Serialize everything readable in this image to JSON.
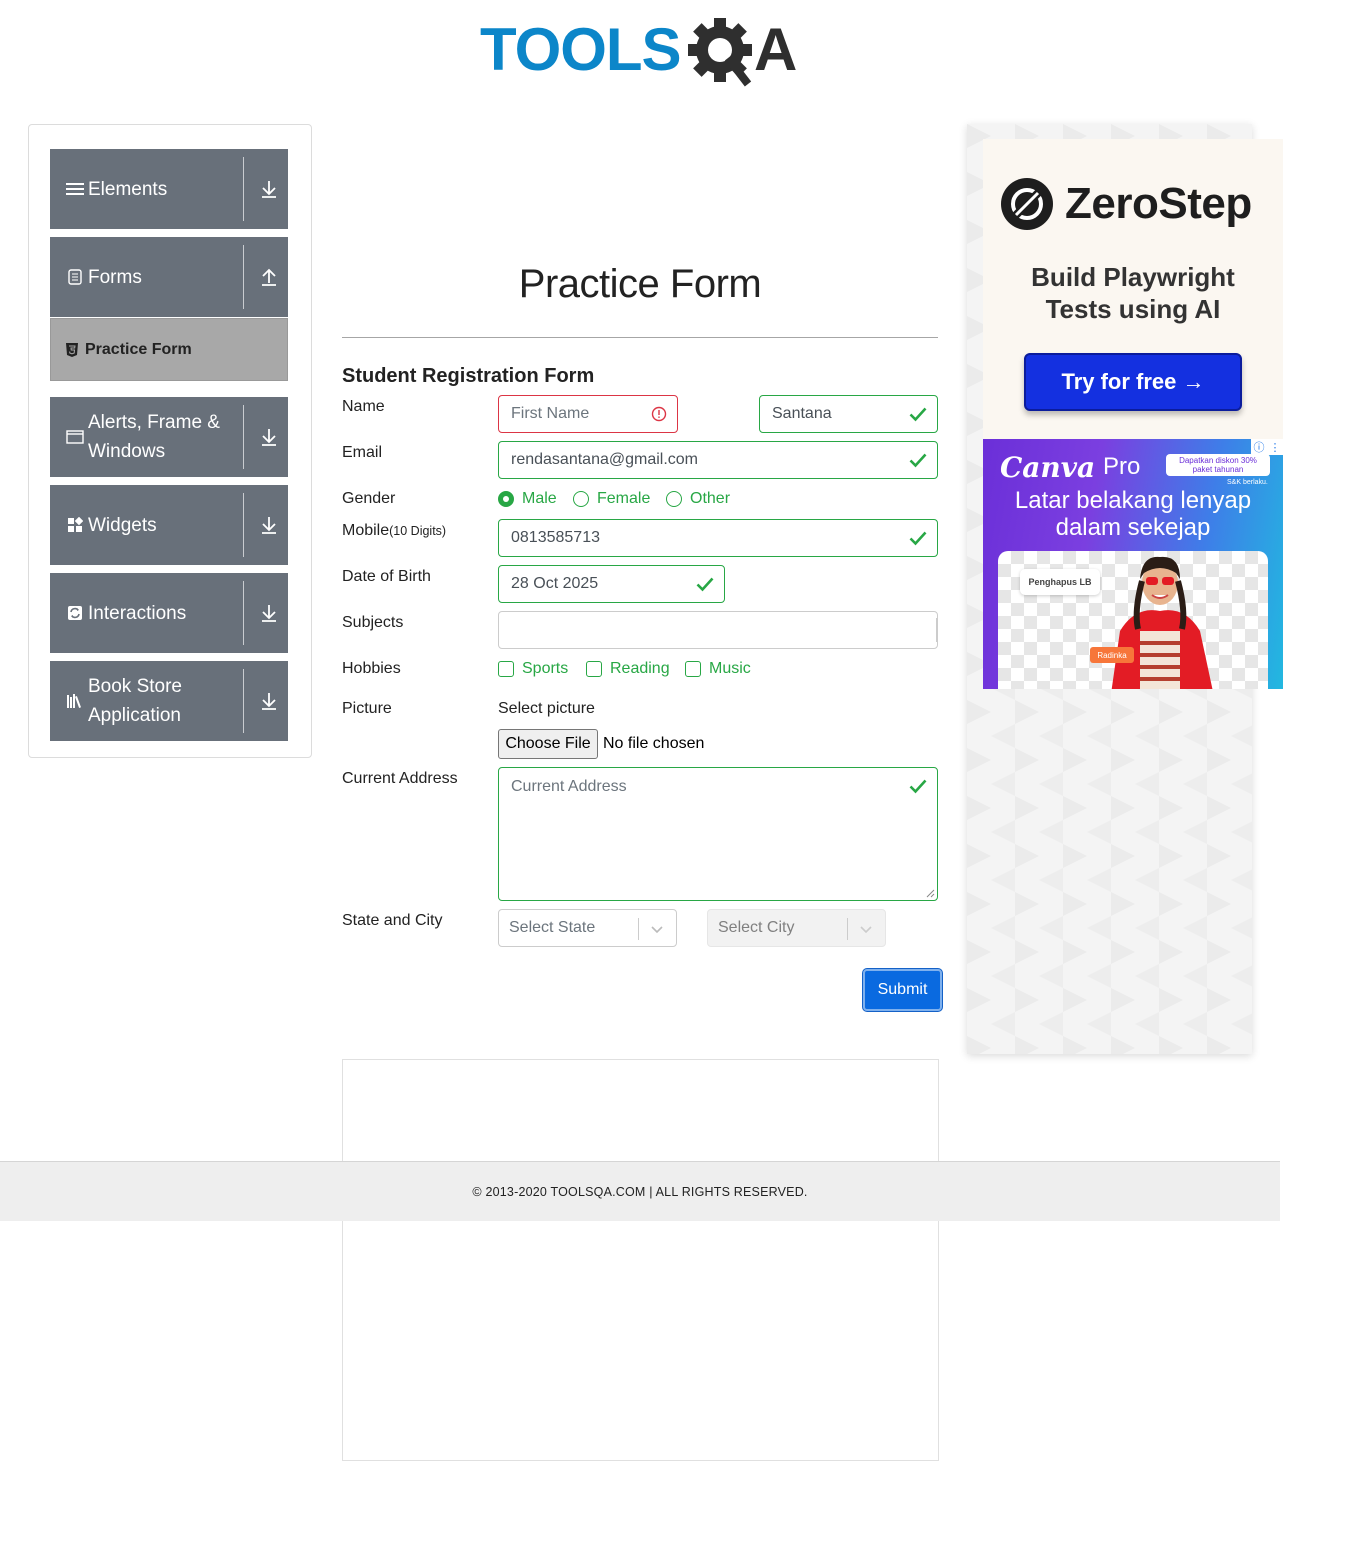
{
  "brand": {
    "name": "TOOLSQA"
  },
  "sidebar": {
    "groups": [
      {
        "label": "Elements",
        "icon": "menu-lines-icon",
        "arrow": "download-arrow-icon"
      },
      {
        "label": "Forms",
        "icon": "document-icon",
        "arrow": "upload-arrow-icon"
      },
      {
        "label": "Alerts, Frame & Windows",
        "icon": "window-icon",
        "arrow": "download-arrow-icon"
      },
      {
        "label": "Widgets",
        "icon": "widgets-icon",
        "arrow": "download-arrow-icon"
      },
      {
        "label": "Interactions",
        "icon": "interactions-icon",
        "arrow": "download-arrow-icon"
      },
      {
        "label": "Book Store Application",
        "icon": "books-icon",
        "arrow": "download-arrow-icon"
      }
    ],
    "active_item": {
      "label": "Practice Form",
      "icon": "html5-icon"
    }
  },
  "main": {
    "title": "Practice Form",
    "form_heading": "Student Registration Form",
    "labels": {
      "name": "Name",
      "email": "Email",
      "gender": "Gender",
      "mobile": "Mobile",
      "mobile_hint": "(10 Digits)",
      "dob": "Date of Birth",
      "subjects": "Subjects",
      "hobbies": "Hobbies",
      "picture": "Picture",
      "address": "Current Address",
      "state_city": "State and City"
    },
    "fields": {
      "first_name_placeholder": "First Name",
      "last_name": "Santana",
      "email": "rendasantana@gmail.com",
      "mobile": "0813585713",
      "dob": "28 Oct 2025",
      "address_placeholder": "Current Address"
    },
    "gender_options": [
      "Male",
      "Female",
      "Other"
    ],
    "gender_selected": "Male",
    "hobbies": [
      "Sports",
      "Reading",
      "Music"
    ],
    "picture": {
      "prompt": "Select picture",
      "button": "Choose File",
      "status": "No file chosen"
    },
    "state_placeholder": "Select State",
    "city_placeholder": "Select City",
    "submit": "Submit"
  },
  "footer": {
    "text": "© 2013-2020 TOOLSQA.COM | ALL RIGHTS RESERVED."
  },
  "ads": {
    "zerostep": {
      "name": "ZeroStep",
      "tagline_1": "Build Playwright",
      "tagline_2": "Tests using AI",
      "cta": "Try for free →"
    },
    "canva": {
      "brand": "Canva",
      "product": "Pro",
      "promo_1": "Dapatkan diskon 30%",
      "promo_2": "paket tahunan",
      "terms": "S&K berlaku.",
      "headline_1": "Latar belakang lenyap",
      "headline_2": "dalam sekejap",
      "chip": "Penghapus LB",
      "tag": "Radinka"
    }
  },
  "colors": {
    "sidebar_group": "#68707a",
    "sidebar_active": "#a8a8a8",
    "valid_green": "#28a745",
    "invalid_red": "#dc3545",
    "submit_blue": "#0a6ae0",
    "logo_blue": "#0c86c9"
  }
}
